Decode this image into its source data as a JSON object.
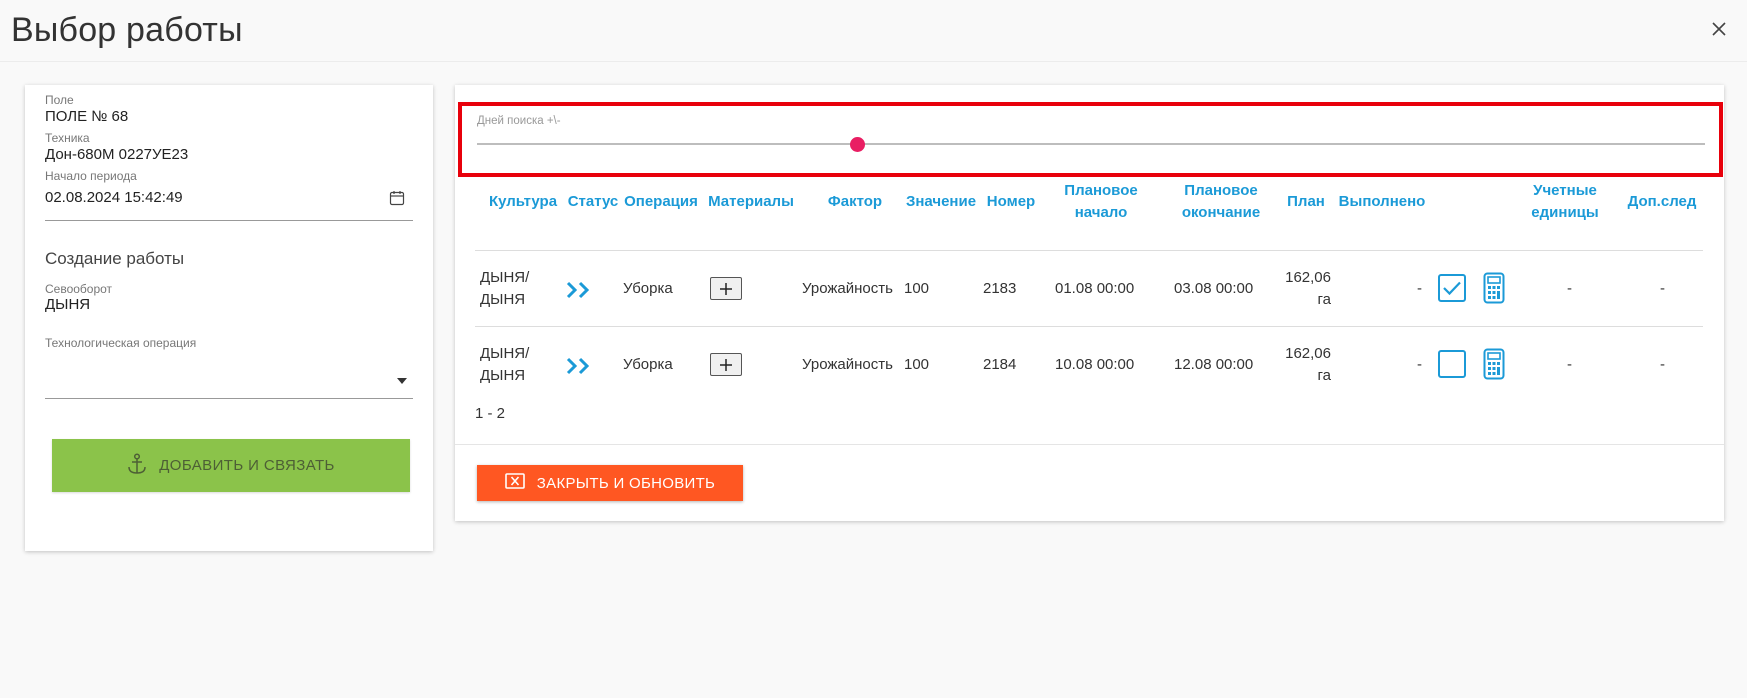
{
  "dialog": {
    "title": "Выбор работы"
  },
  "left": {
    "field_label": "Поле",
    "field_value": "ПОЛЕ № 68",
    "machine_label": "Техника",
    "machine_value": "Дон-680М 0227УЕ23",
    "period_label": "Начало периода",
    "period_value": "02.08.2024 15:42:49",
    "create_title": "Создание работы",
    "rotation_label": "Севооборот",
    "rotation_value": "ДЫНЯ",
    "techop_label": "Технологическая операция",
    "techop_value": "",
    "add_button": "ДОБАВИТЬ И СВЯЗАТЬ"
  },
  "slider": {
    "label": "Дней поиска +\\-",
    "value_fraction": 0.31
  },
  "table": {
    "headers": {
      "culture": "Культура",
      "status": "Статус",
      "operation": "Операция",
      "materials": "Материалы",
      "factor": "Фактор",
      "value": "Значение",
      "number": "Номер",
      "plan_start_1": "Плановое",
      "plan_start_2": "начало",
      "plan_end_1": "Плановое",
      "plan_end_2": "окончание",
      "plan": "План",
      "done": "Выполнено",
      "units_1": "Учетные",
      "units_2": "единицы",
      "extra": "Доп.след"
    },
    "rows": [
      {
        "culture_1": "ДЫНЯ/",
        "culture_2": "ДЫНЯ",
        "operation": "Уборка",
        "factor": "Урожайность",
        "value": "100",
        "number": "2183",
        "plan_start": "01.08 00:00",
        "plan_end": "03.08 00:00",
        "plan_1": "162,06",
        "plan_2": "га",
        "done": "-",
        "checked": true,
        "units": "-",
        "extra": "-"
      },
      {
        "culture_1": "ДЫНЯ/",
        "culture_2": "ДЫНЯ",
        "operation": "Уборка",
        "factor": "Урожайность",
        "value": "100",
        "number": "2184",
        "plan_start": "10.08 00:00",
        "plan_end": "12.08 00:00",
        "plan_1": "162,06",
        "plan_2": "га",
        "done": "-",
        "checked": false,
        "units": "-",
        "extra": "-"
      }
    ],
    "pager": "1 - 2"
  },
  "footer": {
    "close_button": "ЗАКРЫТЬ И ОБНОВИТЬ"
  },
  "colors": {
    "accent_blue": "#1b9ad7",
    "green_button": "#8bc34a",
    "orange_button": "#ff5722",
    "slider_thumb": "#e91e63",
    "highlight_border": "#e8000b"
  }
}
